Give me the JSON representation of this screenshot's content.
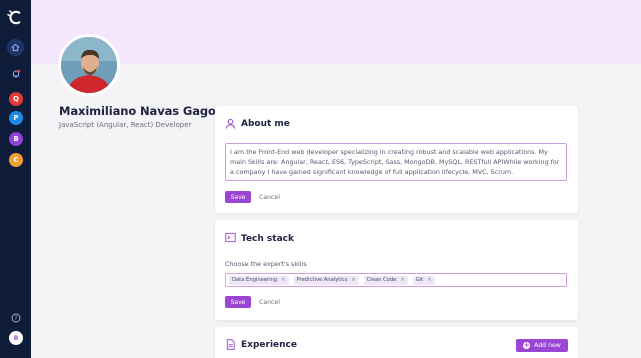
{
  "sidebar": {
    "logo_icon": "c-logo-icon",
    "items": [
      {
        "icon": "home-icon"
      },
      {
        "icon": "bell-icon"
      }
    ],
    "workspaces": [
      {
        "letter": "Q",
        "color": "#e53935"
      },
      {
        "letter": "P",
        "color": "#1e88e5"
      },
      {
        "letter": "B",
        "color": "#8e44d6"
      },
      {
        "letter": "C",
        "color": "#f0a030"
      }
    ],
    "help_icon": "help-icon",
    "user_initial": "B"
  },
  "profile": {
    "name": "Maximiliano Navas Gago",
    "role": "JavaScript (Angular, React) Developer"
  },
  "about": {
    "title": "About me",
    "text": "I am the Front-End web developer specializing in creating robust and scalable web applications. My main Skills are: Angular, React, ES6, TypeScript, Sass, MongoDB, MySQL, RESTfull APIWhile working for a company I have gained significant knowledge of full application lifecycle, MVC, Scrum.",
    "save_label": "Save",
    "cancel_label": "Cancel"
  },
  "tech": {
    "title": "Tech stack",
    "hint": "Choose the expert's skills",
    "tags": [
      "Data Engineering",
      "Predictive Analytics",
      "Clean Code",
      "Git"
    ],
    "remove_glyph": "×",
    "save_label": "Save",
    "cancel_label": "Cancel"
  },
  "experience": {
    "title": "Experience",
    "add_label": "Add new",
    "add_glyph": "+"
  },
  "colors": {
    "accent": "#9b45d5",
    "sidebar": "#0f1c3a",
    "header": "#f5e7fb"
  }
}
